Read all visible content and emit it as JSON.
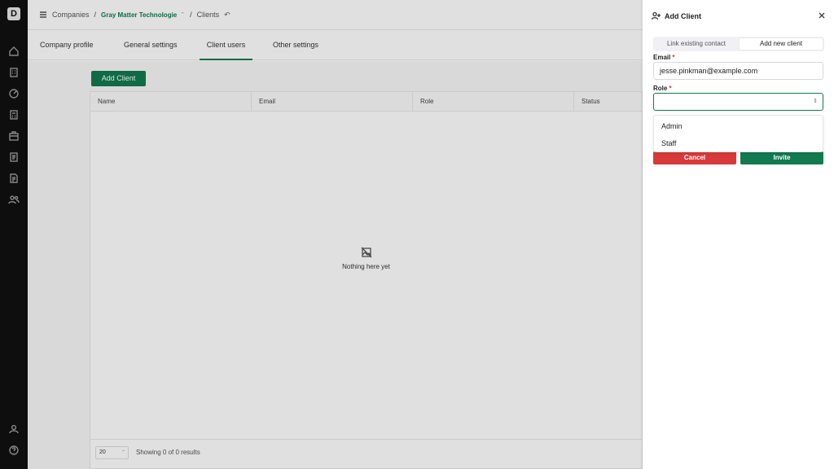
{
  "rail": {
    "logo_text": "D"
  },
  "topbar": {
    "crumbs": [
      "Companies",
      "Gray Matter Technologie",
      "Clients"
    ],
    "separator": "/",
    "chevron": "⌃",
    "undo_glyph": "↶"
  },
  "tabs": [
    "Company profile",
    "General settings",
    "Client users",
    "Other settings"
  ],
  "content": {
    "add_button": "Add Client",
    "columns": [
      "Name",
      "Email",
      "Role",
      "Status"
    ],
    "empty_text": "Nothing here yet",
    "page_size": "20",
    "showing": "Showing 0 of 0 results"
  },
  "panel": {
    "title": "Add Client",
    "segments": [
      "Link existing contact",
      "Add new client"
    ],
    "email_label": "Email",
    "email_value": "jesse.pinkman@example.com",
    "role_label": "Role",
    "required_mark": "*",
    "role_options": [
      "Admin",
      "Staff"
    ],
    "cancel": "Cancel",
    "invite": "Invite"
  },
  "colors": {
    "accent": "#127a50",
    "danger": "#d83a3a",
    "rail": "#111111"
  }
}
